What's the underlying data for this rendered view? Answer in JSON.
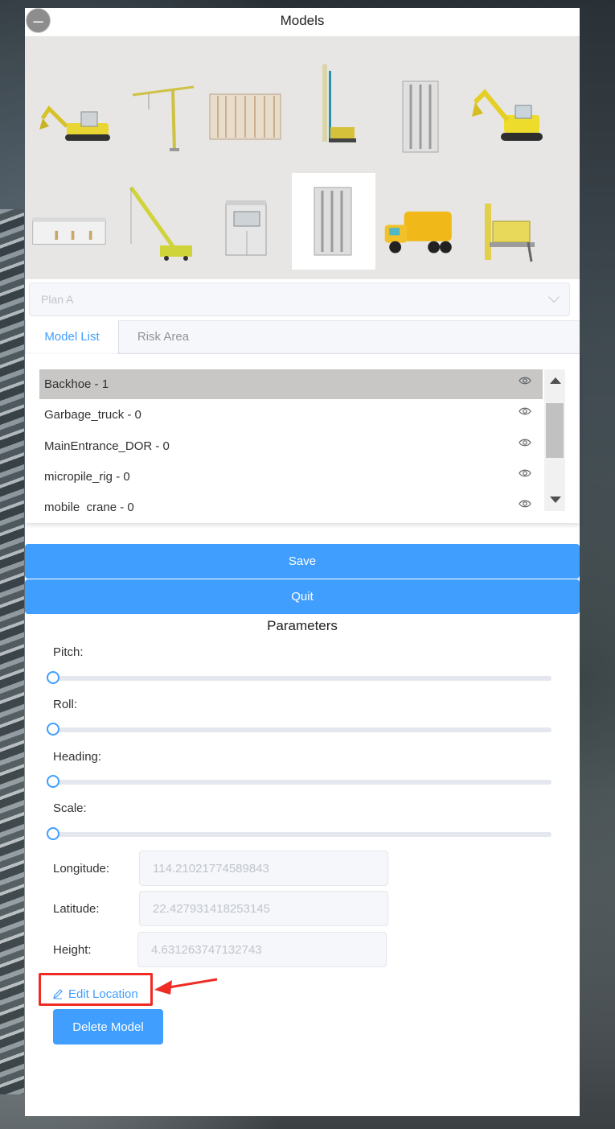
{
  "panel": {
    "title": "Models"
  },
  "gallery": {
    "models": [
      {
        "name": "backhoe",
        "selected": false
      },
      {
        "name": "tower-crane",
        "selected": false
      },
      {
        "name": "fence-panels",
        "selected": false
      },
      {
        "name": "micropile-rig",
        "selected": false
      },
      {
        "name": "door-panel",
        "selected": false
      },
      {
        "name": "excavator",
        "selected": false
      },
      {
        "name": "site-office",
        "selected": false
      },
      {
        "name": "mobile-crane",
        "selected": false
      },
      {
        "name": "guard-house",
        "selected": false
      },
      {
        "name": "main-entrance-door",
        "selected": true
      },
      {
        "name": "garbage-truck",
        "selected": false
      },
      {
        "name": "drilling-rig",
        "selected": false
      }
    ]
  },
  "plan_select": {
    "value": "Plan A"
  },
  "tabs": [
    {
      "label": "Model List",
      "active": true
    },
    {
      "label": "Risk Area",
      "active": false
    }
  ],
  "model_list": {
    "items": [
      {
        "label": "Backhoe - 1",
        "selected": true
      },
      {
        "label": "Garbage_truck - 0",
        "selected": false
      },
      {
        "label": "MainEntrance_DOR - 0",
        "selected": false
      },
      {
        "label": "micropile_rig - 0",
        "selected": false
      },
      {
        "label": "mobile  crane - 0",
        "selected": false
      }
    ]
  },
  "actions": {
    "save_label": "Save",
    "quit_label": "Quit"
  },
  "parameters": {
    "title": "Parameters",
    "sliders": [
      {
        "label": "Pitch:",
        "value": 0
      },
      {
        "label": "Roll:",
        "value": 0
      },
      {
        "label": "Heading:",
        "value": 0
      },
      {
        "label": "Scale:",
        "value": 0
      }
    ],
    "longitude": {
      "label": "Longitude:",
      "value": "114.21021774589843"
    },
    "latitude": {
      "label": "Latitude:",
      "value": "22.427931418253145"
    },
    "height": {
      "label": "Height:",
      "value": "4.631263747132743"
    },
    "edit_location_label": "Edit Location",
    "delete_label": "Delete Model"
  },
  "colors": {
    "accent": "#409eff",
    "highlight": "#ef2b23"
  }
}
